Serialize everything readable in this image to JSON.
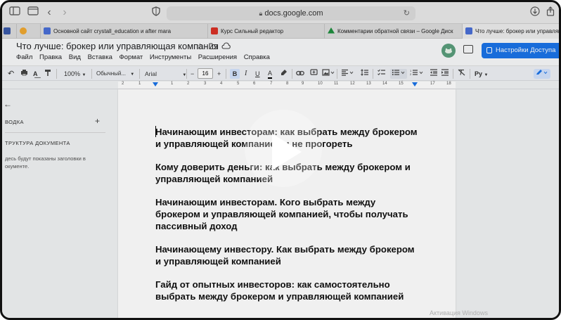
{
  "browser": {
    "url": "docs.google.com",
    "tabs": [
      {
        "label": "Основной сайт crystall_education и after marat...",
        "color": "#4a6fd6"
      },
      {
        "label": "Курс Сильный редактор",
        "color": "#d93025"
      },
      {
        "label": "Комментарии обратной связи – Google Диск",
        "color": "#1e8e3e"
      },
      {
        "label": "Что лучше: брокер или управляющая...",
        "color": "#4a6fd6"
      }
    ]
  },
  "docs": {
    "title": "Что лучше: брокер или управляющая компания",
    "menu": [
      "Файл",
      "Правка",
      "Вид",
      "Вставка",
      "Формат",
      "Инструменты",
      "Расширения",
      "Справка"
    ],
    "share_label": "Настройки Доступа",
    "toolbar": {
      "zoom": "100%",
      "style": "Обычный...",
      "font": "Arial",
      "font_size": "16",
      "bold": "B",
      "italic": "I",
      "underline": "U",
      "text_color": "A"
    },
    "ruler_numbers": [
      "2",
      "1",
      "1",
      "2",
      "3",
      "4",
      "5",
      "6",
      "7",
      "8",
      "9",
      "10",
      "11",
      "12",
      "13",
      "14",
      "15",
      "16",
      "17",
      "18"
    ]
  },
  "outline": {
    "summary_label": "ВОДКА",
    "structure_label": "ТРУКТУРА ДОКУМЕНТА",
    "hint": "десь будут показаны заголовки в окументе."
  },
  "document": {
    "paragraphs": [
      "Начинающим инвесторам: как выбрать между брокером и управляющей компанией и не прогореть",
      "Кому доверить деньги: как выбрать между брокером и управляющей компанией",
      "Начинающим инвесторам. Кого выбрать между брокером и управляющей компанией, чтобы получать пассивный доход",
      "Начинающему инвестору. Как выбрать между брокером и управляющей компанией",
      "Гайд от опытных инвесторов: как самостоятельно выбрать между брокером и управляющей компанией"
    ]
  },
  "watermark": "Активация Windows"
}
